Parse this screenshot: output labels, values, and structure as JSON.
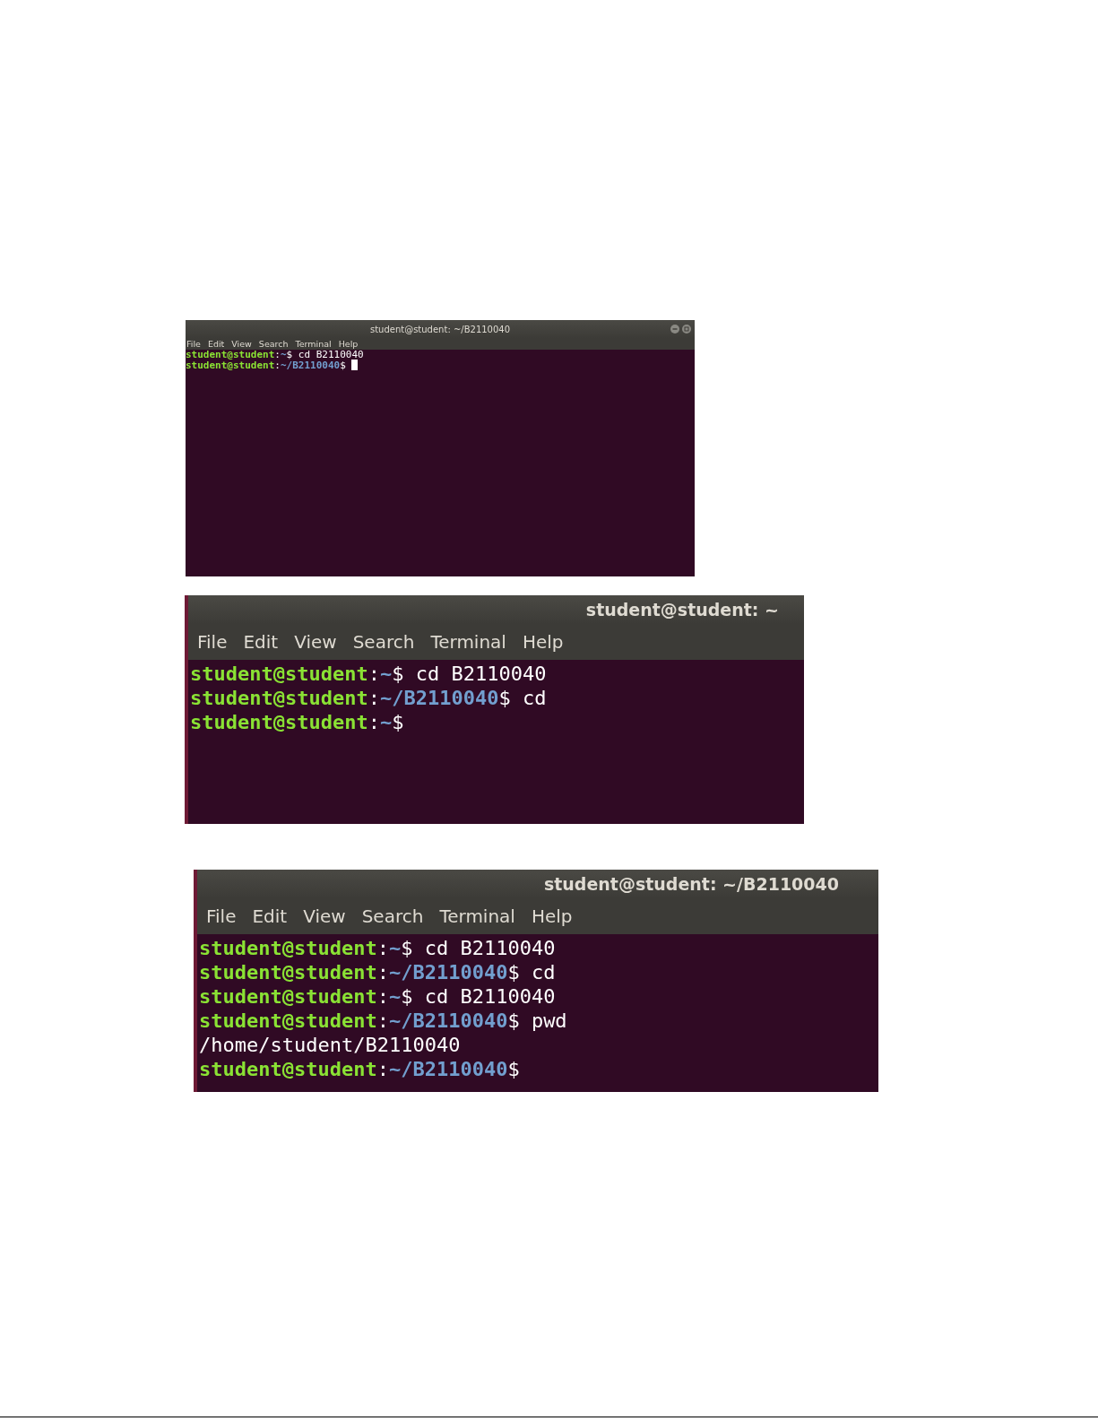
{
  "windows": [
    {
      "title": "student@student: ~/B2110040",
      "menu": [
        "File",
        "Edit",
        "View",
        "Search",
        "Terminal",
        "Help"
      ],
      "window_buttons": true,
      "lines": [
        [
          {
            "kind": "user",
            "text": "student@student"
          },
          {
            "kind": "sep",
            "text": ":"
          },
          {
            "kind": "path",
            "text": "~"
          },
          {
            "kind": "plain",
            "text": "$ cd B2110040"
          }
        ],
        [
          {
            "kind": "user",
            "text": "student@student"
          },
          {
            "kind": "sep",
            "text": ":"
          },
          {
            "kind": "path",
            "text": "~/B2110040"
          },
          {
            "kind": "plain",
            "text": "$ "
          },
          {
            "kind": "cursor"
          }
        ]
      ]
    },
    {
      "title": "student@student: ~",
      "menu": [
        "File",
        "Edit",
        "View",
        "Search",
        "Terminal",
        "Help"
      ],
      "window_buttons": false,
      "lines": [
        [
          {
            "kind": "user",
            "text": "student@student"
          },
          {
            "kind": "sep",
            "text": ":"
          },
          {
            "kind": "path",
            "text": "~"
          },
          {
            "kind": "plain",
            "text": "$ cd B2110040"
          }
        ],
        [
          {
            "kind": "user",
            "text": "student@student"
          },
          {
            "kind": "sep",
            "text": ":"
          },
          {
            "kind": "path",
            "text": "~/B2110040"
          },
          {
            "kind": "plain",
            "text": "$ cd"
          }
        ],
        [
          {
            "kind": "user",
            "text": "student@student"
          },
          {
            "kind": "sep",
            "text": ":"
          },
          {
            "kind": "path",
            "text": "~"
          },
          {
            "kind": "plain",
            "text": "$"
          }
        ]
      ]
    },
    {
      "title": "student@student: ~/B2110040",
      "menu": [
        "File",
        "Edit",
        "View",
        "Search",
        "Terminal",
        "Help"
      ],
      "window_buttons": false,
      "lines": [
        [
          {
            "kind": "user",
            "text": "student@student"
          },
          {
            "kind": "sep",
            "text": ":"
          },
          {
            "kind": "path",
            "text": "~"
          },
          {
            "kind": "plain",
            "text": "$ cd B2110040"
          }
        ],
        [
          {
            "kind": "user",
            "text": "student@student"
          },
          {
            "kind": "sep",
            "text": ":"
          },
          {
            "kind": "path",
            "text": "~/B2110040"
          },
          {
            "kind": "plain",
            "text": "$ cd"
          }
        ],
        [
          {
            "kind": "user",
            "text": "student@student"
          },
          {
            "kind": "sep",
            "text": ":"
          },
          {
            "kind": "path",
            "text": "~"
          },
          {
            "kind": "plain",
            "text": "$ cd B2110040"
          }
        ],
        [
          {
            "kind": "user",
            "text": "student@student"
          },
          {
            "kind": "sep",
            "text": ":"
          },
          {
            "kind": "path",
            "text": "~/B2110040"
          },
          {
            "kind": "plain",
            "text": "$ pwd"
          }
        ],
        [
          {
            "kind": "plain",
            "text": "/home/student/B2110040"
          }
        ],
        [
          {
            "kind": "user",
            "text": "student@student"
          },
          {
            "kind": "sep",
            "text": ":"
          },
          {
            "kind": "path",
            "text": "~/B2110040"
          },
          {
            "kind": "plain",
            "text": "$"
          }
        ]
      ]
    }
  ]
}
